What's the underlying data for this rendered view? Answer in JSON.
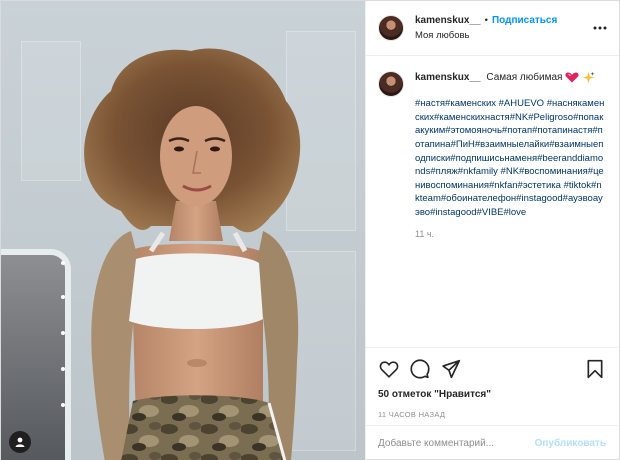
{
  "post": {
    "username": "kamenskux__",
    "follow_label": "Подписаться",
    "separator": "•",
    "location": "Моя любовь",
    "caption_text": "Самая любимая",
    "hashtags": "#настя#каменских #AHUEVO #наснякаменских#каменскихнастя#NK#Peligroso#попакакуким#этомояночь#потап#потапинастя#потапина#ПиН#взаимныелайки#взаимныеподписки#подпишисьнаменя#beeranddiamonds#пляж#nkfamily #NK#воспоминания#ценивоспоминания#nkfan#эстетика #tiktok#nkteam#обоинателефон#instagood#ауэвоауэво#instagood#VIBE#love",
    "caption_time": "11 ч.",
    "likes": "50 отметок \"Нравится\"",
    "timestamp": "11 ЧАСОВ НАЗАД",
    "comment_placeholder": "Добавьте комментарий...",
    "publish_label": "Опубликовать"
  },
  "icons": {
    "more": "more-horizontal-icon",
    "like": "heart-icon",
    "comment": "comment-icon",
    "share": "send-icon",
    "save": "bookmark-icon",
    "tagged_user": "user-tag-icon",
    "emoji_1": "heart-emoji-icon",
    "emoji_2": "sparkle-emoji-icon"
  },
  "colors": {
    "link_blue": "#0095f6",
    "hashtag": "#00376b",
    "muted": "#8e8e8e",
    "publish_disabled": "#b2dffc",
    "heart_emoji": "#e0245e",
    "sparkle_emoji": "#f4c23a"
  }
}
